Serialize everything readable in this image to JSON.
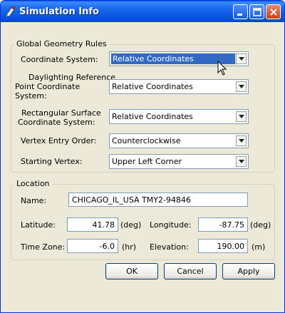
{
  "window": {
    "title": "Simulation Info",
    "controls": {
      "minimize": "minimize-icon",
      "maximize": "maximize-icon",
      "close": "close-icon"
    }
  },
  "geometry_rules": {
    "legend": "Global Geometry Rules",
    "coordinate_system": {
      "label": "Coordinate System:",
      "value": "Relative Coordinates"
    },
    "daylighting": {
      "label_line1": "Daylighting Reference",
      "label_line2": "Point Coordinate",
      "label_line3": "System:",
      "value": "Relative Coordinates"
    },
    "rect_surface": {
      "label_line1": "Rectangular Surface",
      "label_line2": "Coordinate System:",
      "value": "Relative Coordinates"
    },
    "vertex_order": {
      "label": "Vertex Entry Order:",
      "value": "Counterclockwise"
    },
    "starting_vertex": {
      "label": "Starting Vertex:",
      "value": "Upper Left Corner"
    }
  },
  "location": {
    "legend": "Location",
    "name": {
      "label": "Name:",
      "value": "CHICAGO_IL_USA TMY2-94846"
    },
    "latitude": {
      "label": "Latitude:",
      "value": "41.78",
      "unit": "(deg)"
    },
    "longitude": {
      "label": "Longitude:",
      "value": "-87.75",
      "unit": "(deg)"
    },
    "time_zone": {
      "label": "Time Zone:",
      "value": "-6.0",
      "unit": "(hr)"
    },
    "elevation": {
      "label": "Elevation:",
      "value": "190.00",
      "unit": "(m)"
    }
  },
  "buttons": {
    "ok": "OK",
    "cancel": "Cancel",
    "apply": "Apply"
  }
}
